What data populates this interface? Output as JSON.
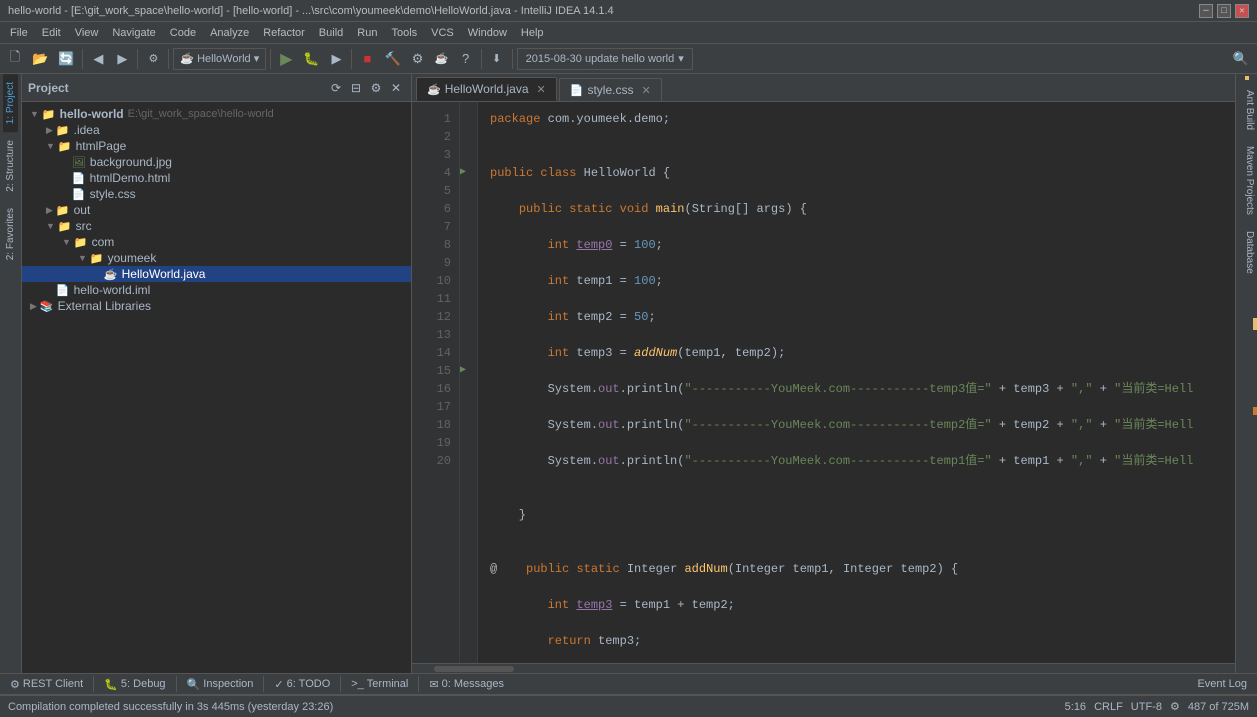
{
  "title_bar": {
    "title": "hello-world - [E:\\git_work_space\\hello-world] - [hello-world] - ...\\src\\com\\youmeek\\demo\\HelloWorld.java - IntelliJ IDEA 14.1.4",
    "min_btn": "─",
    "max_btn": "□",
    "close_btn": "✕"
  },
  "menu": {
    "items": [
      "File",
      "Edit",
      "View",
      "Navigate",
      "Code",
      "Analyze",
      "Refactor",
      "Build",
      "Run",
      "Tools",
      "VCS",
      "Window",
      "Help"
    ]
  },
  "toolbar": {
    "branch_label": "HelloWorld ▾",
    "vcs_commit": "2015-08-30  update hello world",
    "vcs_chevron": "▾"
  },
  "project_panel": {
    "label": "Project",
    "root": {
      "name": "hello-world",
      "path": "E:\\git_work_space\\hello-world",
      "children": [
        {
          "name": ".idea",
          "type": "folder",
          "indent": 2
        },
        {
          "name": "htmlPage",
          "type": "folder",
          "indent": 2,
          "expanded": true,
          "children": [
            {
              "name": "background.jpg",
              "type": "image",
              "indent": 3
            },
            {
              "name": "htmlDemo.html",
              "type": "html",
              "indent": 3
            },
            {
              "name": "style.css",
              "type": "css",
              "indent": 3
            }
          ]
        },
        {
          "name": "out",
          "type": "folder",
          "indent": 2
        },
        {
          "name": "src",
          "type": "folder",
          "indent": 2,
          "expanded": true,
          "children": [
            {
              "name": "com",
              "type": "folder",
              "indent": 3,
              "expanded": true,
              "children": [
                {
                  "name": "youmeek",
                  "type": "folder",
                  "indent": 4,
                  "expanded": true,
                  "children": [
                    {
                      "name": "HelloWorld.java",
                      "type": "java",
                      "indent": 5,
                      "selected": true
                    }
                  ]
                }
              ]
            }
          ]
        },
        {
          "name": "hello-world.iml",
          "type": "iml",
          "indent": 2
        }
      ]
    },
    "external_libraries": "External Libraries"
  },
  "editor": {
    "tabs": [
      {
        "name": "HelloWorld.java",
        "type": "java",
        "active": true
      },
      {
        "name": "style.css",
        "type": "css",
        "active": false
      }
    ],
    "code_lines": [
      {
        "num": 1,
        "content": "package com.youmeek.demo;"
      },
      {
        "num": 2,
        "content": ""
      },
      {
        "num": 3,
        "content": "public class HelloWorld {"
      },
      {
        "num": 4,
        "content": "    public static void main(String[] args) {",
        "gutter": "▶"
      },
      {
        "num": 5,
        "content": "        int temp0 = 100;"
      },
      {
        "num": 6,
        "content": "        int temp1 = 100;"
      },
      {
        "num": 7,
        "content": "        int temp2 = 50;"
      },
      {
        "num": 8,
        "content": "        int temp3 = addNum(temp1, temp2);"
      },
      {
        "num": 9,
        "content": "        System.out.println(\"-----------YouMeek.com-----------temp3值=\" + temp3 + \",\" + \"当前类=Hell"
      },
      {
        "num": 10,
        "content": "        System.out.println(\"-----------YouMeek.com-----------temp2值=\" + temp2 + \",\" + \"当前类=Hell"
      },
      {
        "num": 11,
        "content": "        System.out.println(\"-----------YouMeek.com-----------temp1值=\" + temp1 + \",\" + \"当前类=Hell"
      },
      {
        "num": 12,
        "content": ""
      },
      {
        "num": 13,
        "content": "    }"
      },
      {
        "num": 14,
        "content": ""
      },
      {
        "num": 15,
        "content": "    public static Integer addNum(Integer temp1, Integer temp2) {",
        "gutter": "▶",
        "annotation": "@"
      },
      {
        "num": 16,
        "content": "        int temp3 = temp1 + temp2;"
      },
      {
        "num": 17,
        "content": "        return temp3;"
      },
      {
        "num": 18,
        "content": "    }"
      },
      {
        "num": 19,
        "content": "}"
      },
      {
        "num": 20,
        "content": ""
      }
    ]
  },
  "bottom_tools": {
    "items": [
      {
        "icon": "⚙",
        "label": "REST Client"
      },
      {
        "icon": "🐛",
        "label": "5: Debug",
        "num": "5"
      },
      {
        "icon": "🔍",
        "label": "Inspection"
      },
      {
        "icon": "✓",
        "label": "6: TODO",
        "num": "6"
      },
      {
        "icon": ">_",
        "label": "Terminal"
      },
      {
        "icon": "✉",
        "label": "0: Messages",
        "num": "0"
      }
    ],
    "event_log": "Event Log"
  },
  "status_bar": {
    "message": "Compilation completed successfully in 3s 445ms (yesterday 23:26)",
    "position": "5:16",
    "line_ending": "CRLF",
    "encoding": "UTF-8",
    "indent_icon": "⚙",
    "line_col": "487 of 725M"
  },
  "side_tabs": {
    "left": [
      "1: Project",
      "2: Structure",
      "2: Favorites"
    ],
    "right": [
      "Ant Build",
      "Maven Projects",
      "Database"
    ]
  }
}
